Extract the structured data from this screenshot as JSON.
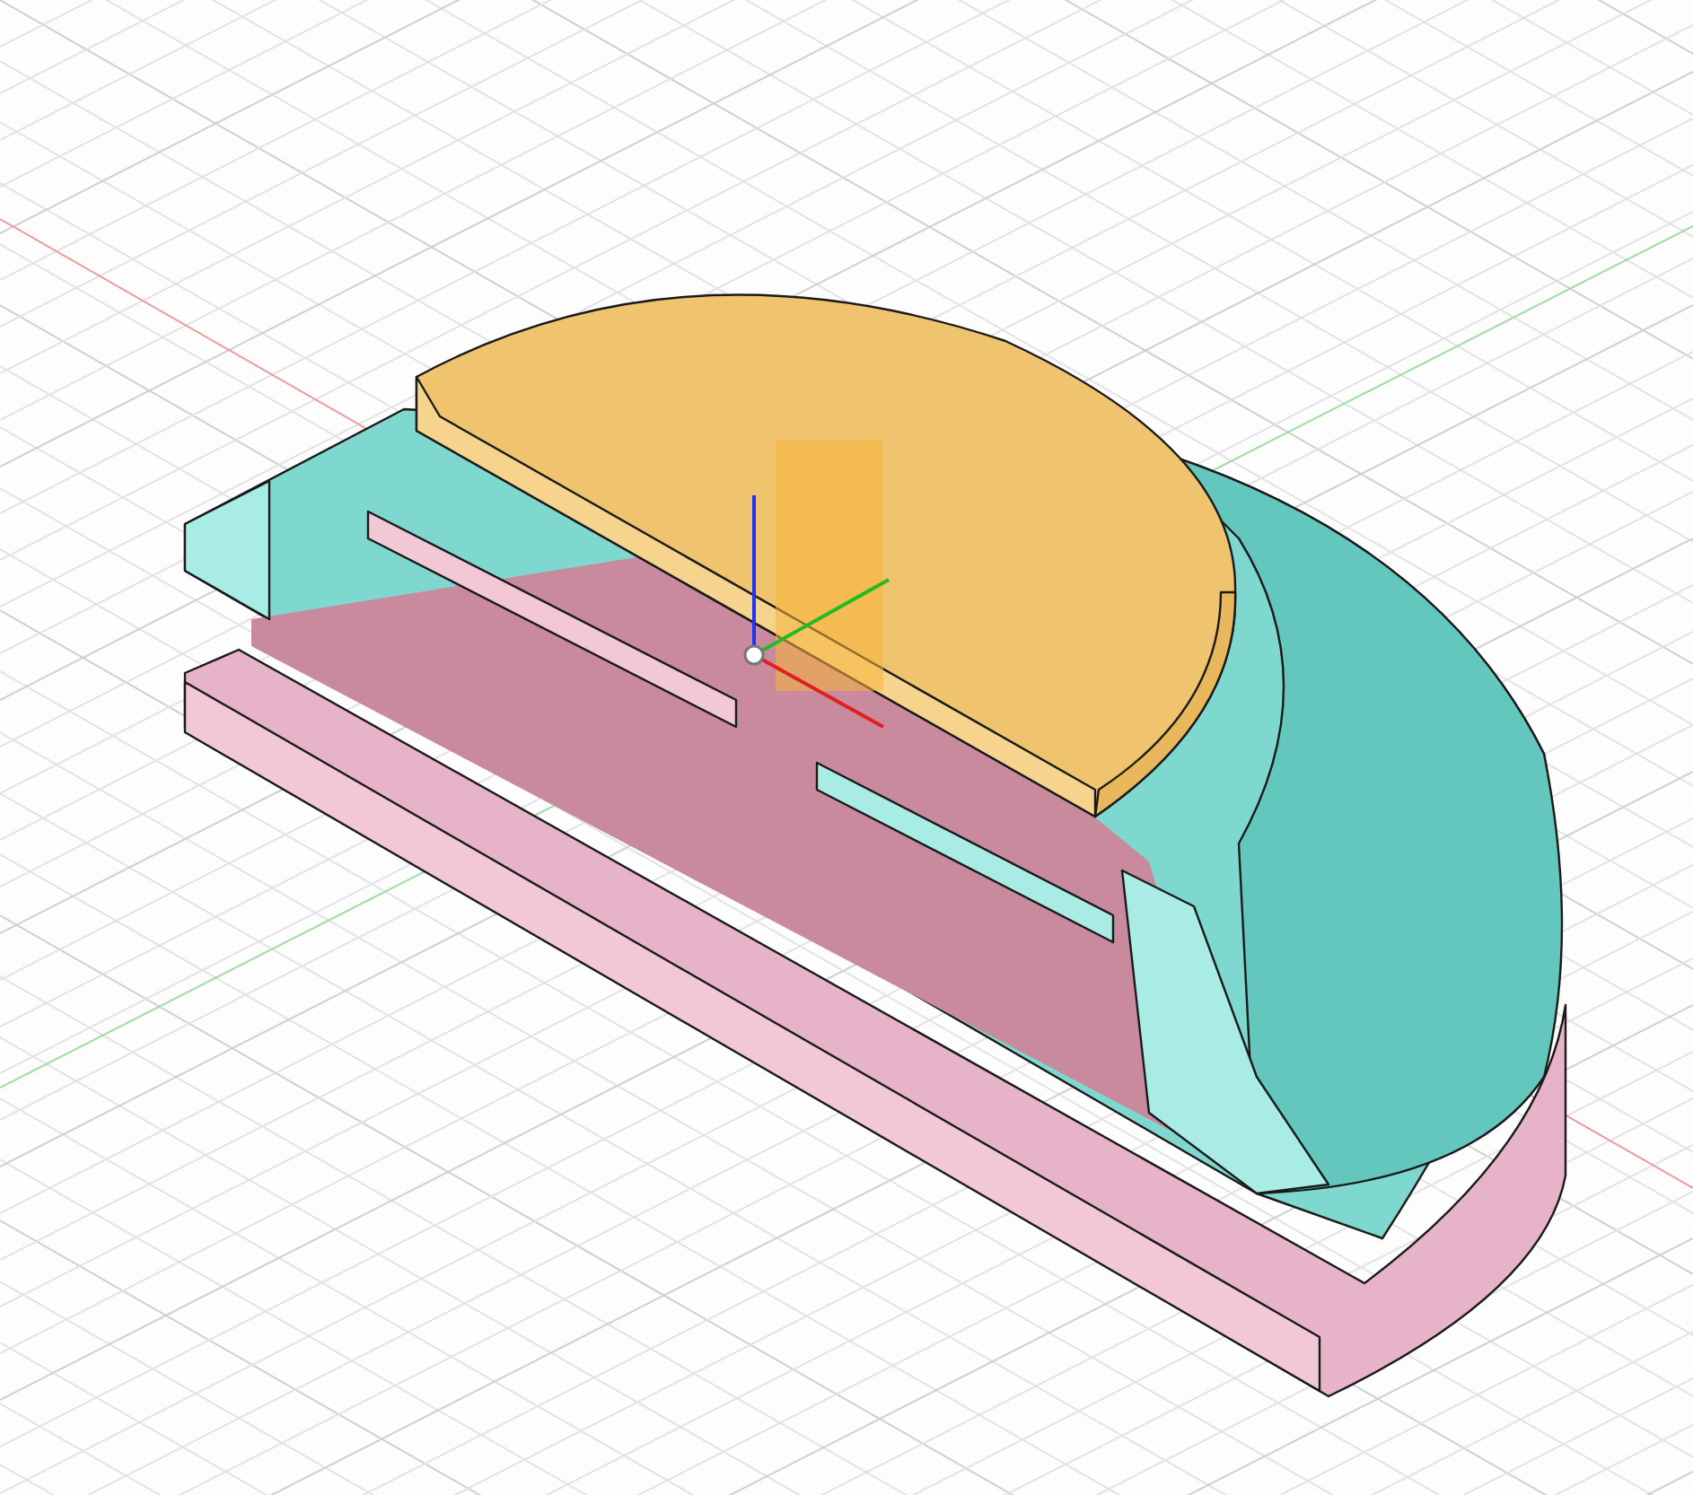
{
  "viewport": {
    "grid": true,
    "axes": true,
    "triad": true
  }
}
